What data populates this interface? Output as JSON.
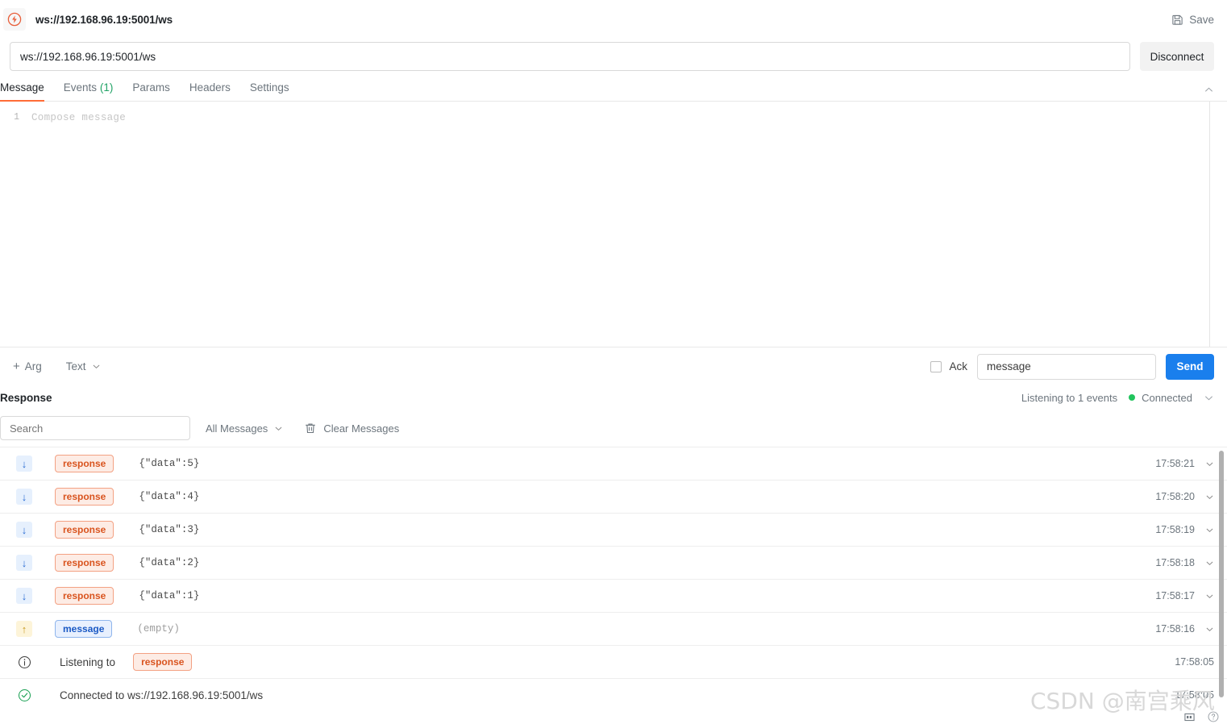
{
  "window": {
    "title": "ws://192.168.96.19:5001/ws",
    "logo_icon": "websocket-bolt-icon",
    "save_label": "Save",
    "save_icon": "floppy-disk-icon"
  },
  "url_bar": {
    "value": "ws://192.168.96.19:5001/ws",
    "placeholder": "Enter WebSocket URL",
    "disconnect_label": "Disconnect"
  },
  "tabs": [
    {
      "label": "Message",
      "count": "",
      "active": true
    },
    {
      "label": "Events",
      "count": "(1)",
      "active": false
    },
    {
      "label": "Params",
      "count": "",
      "active": false
    },
    {
      "label": "Headers",
      "count": "",
      "active": false
    },
    {
      "label": "Settings",
      "count": "",
      "active": false
    }
  ],
  "collapse_icon": "chevron-up-icon",
  "editor": {
    "line_number": "1",
    "placeholder": "Compose message"
  },
  "send_toolbar": {
    "add_arg_label": "Arg",
    "add_arg_plus": "+",
    "format_label": "Text",
    "format_chevron": "chevron-down-icon",
    "ack_label": "Ack",
    "ack_checked": false,
    "event_name_value": "message",
    "event_name_placeholder": "Event name",
    "send_label": "Send"
  },
  "response": {
    "title": "Response",
    "listening_label": "Listening to 1 events",
    "connection_status": "Connected",
    "status_color": "#21c45d",
    "status_chevron": "chevron-down-icon",
    "search_placeholder": "Search",
    "search_value": "",
    "filter_label": "All Messages",
    "filter_chevron": "chevron-down-icon",
    "clear_label": "Clear Messages",
    "clear_icon": "trash-icon"
  },
  "messages": [
    {
      "kind": "data",
      "direction": "in",
      "dir_icon": "arrow-down-icon",
      "badge": "response",
      "badge_type": "response",
      "payload": "{\"data\":5}",
      "timestamp": "17:58:21",
      "chevron": "chevron-down-icon"
    },
    {
      "kind": "data",
      "direction": "in",
      "dir_icon": "arrow-down-icon",
      "badge": "response",
      "badge_type": "response",
      "payload": "{\"data\":4}",
      "timestamp": "17:58:20",
      "chevron": "chevron-down-icon"
    },
    {
      "kind": "data",
      "direction": "in",
      "dir_icon": "arrow-down-icon",
      "badge": "response",
      "badge_type": "response",
      "payload": "{\"data\":3}",
      "timestamp": "17:58:19",
      "chevron": "chevron-down-icon"
    },
    {
      "kind": "data",
      "direction": "in",
      "dir_icon": "arrow-down-icon",
      "badge": "response",
      "badge_type": "response",
      "payload": "{\"data\":2}",
      "timestamp": "17:58:18",
      "chevron": "chevron-down-icon"
    },
    {
      "kind": "data",
      "direction": "in",
      "dir_icon": "arrow-down-icon",
      "badge": "response",
      "badge_type": "response",
      "payload": "{\"data\":1}",
      "timestamp": "17:58:17",
      "chevron": "chevron-down-icon"
    },
    {
      "kind": "data",
      "direction": "out",
      "dir_icon": "arrow-up-icon",
      "badge": "message",
      "badge_type": "message",
      "payload": "(empty)",
      "timestamp": "17:58:16",
      "chevron": "chevron-down-icon"
    },
    {
      "kind": "system",
      "direction": "info",
      "dir_icon": "info-circle-icon",
      "label": "Listening to",
      "badge": "response",
      "badge_type": "response",
      "timestamp": "17:58:05",
      "chevron": ""
    },
    {
      "kind": "system",
      "direction": "success",
      "dir_icon": "check-circle-icon",
      "label": "Connected to ws://192.168.96.19:5001/ws",
      "badge": "",
      "badge_type": "",
      "timestamp": "17:58:05",
      "chevron": ""
    }
  ],
  "watermark": "CSDN @南宫乘风",
  "corner": {
    "layout_icon": "layout-grid-icon",
    "help_icon": "help-circle-icon"
  }
}
